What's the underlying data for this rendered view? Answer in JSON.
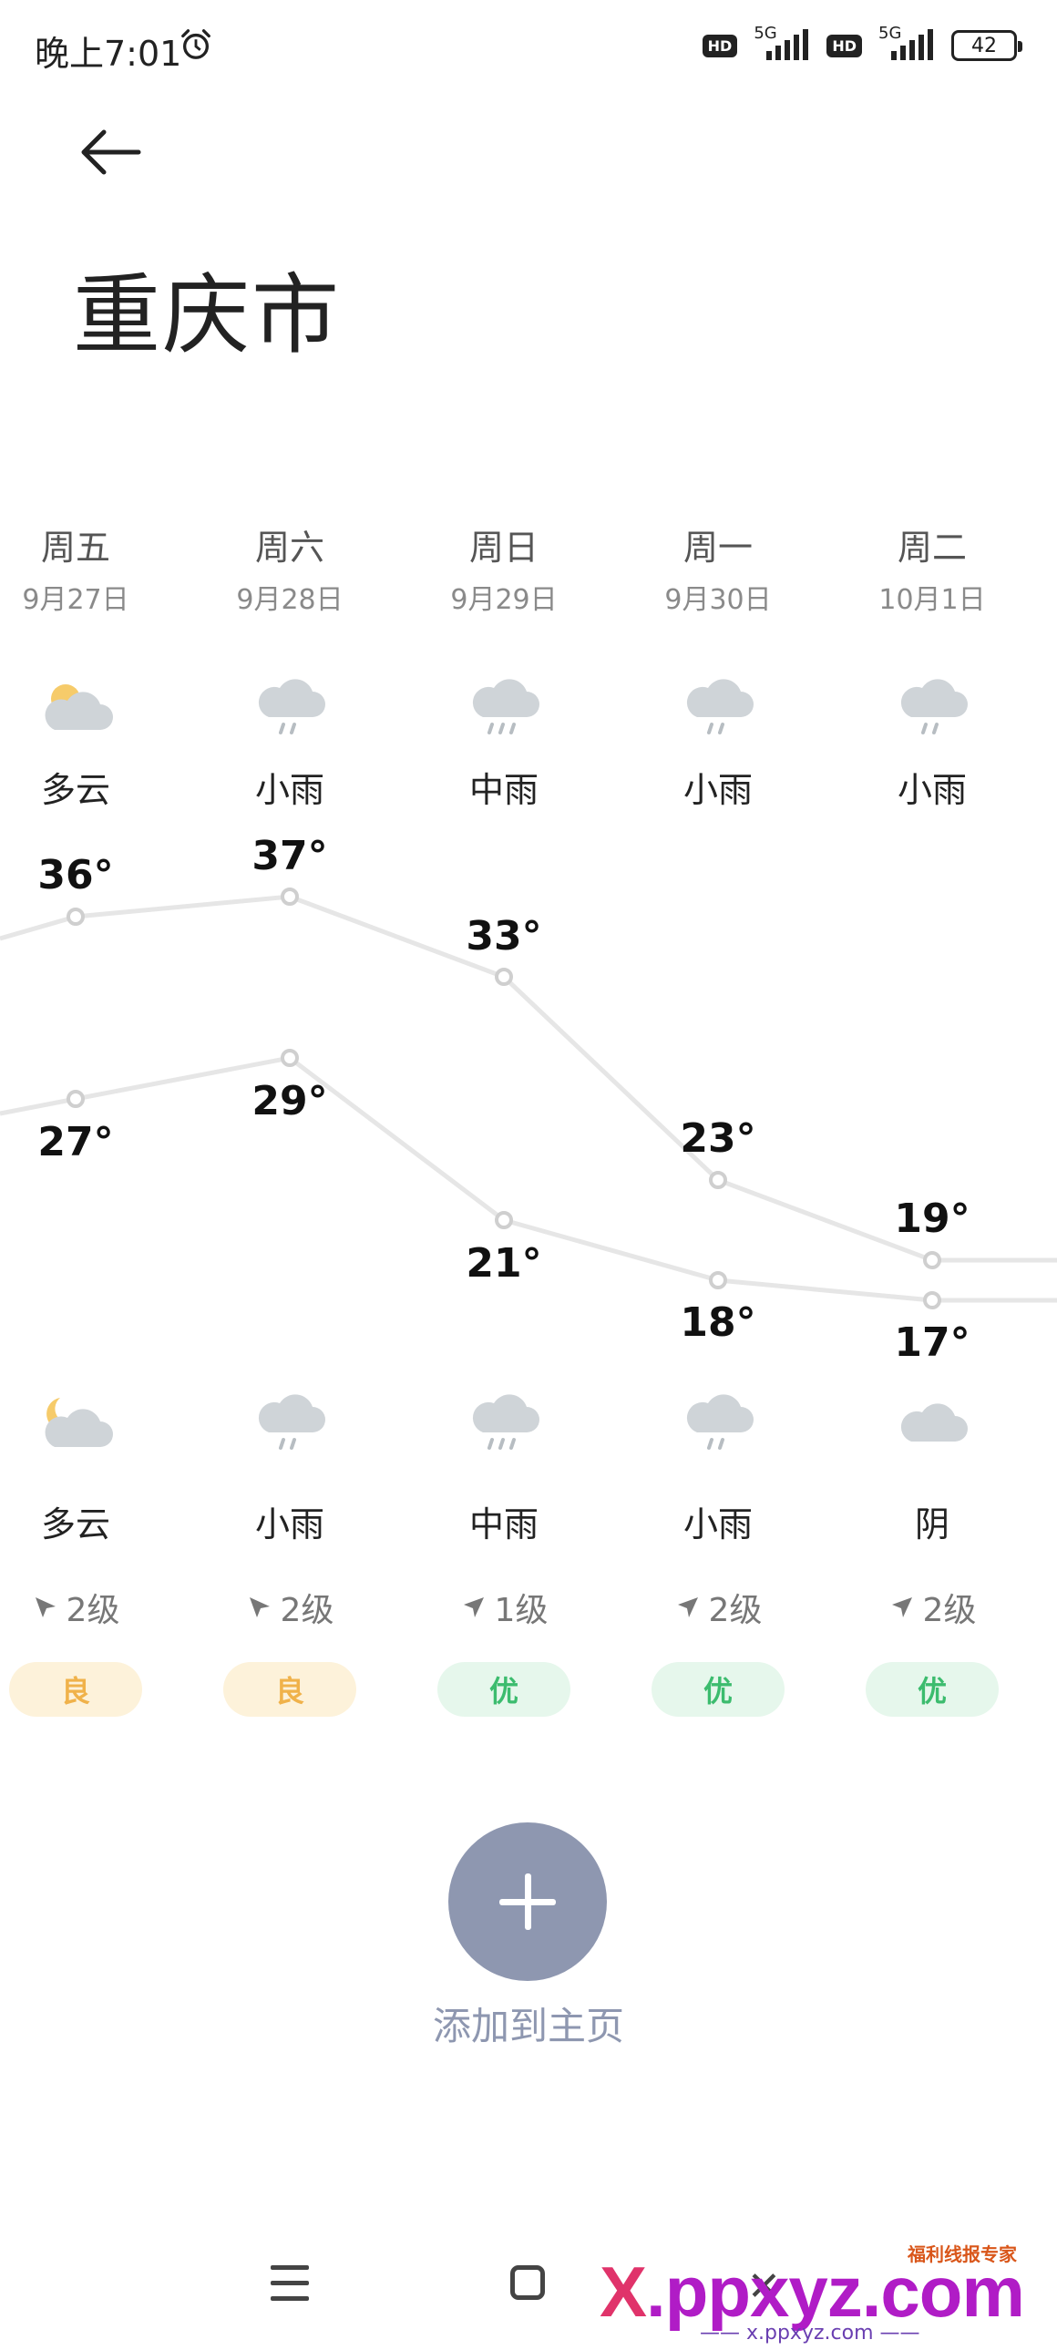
{
  "status_bar": {
    "time": "晚上7:01",
    "hd1": "HD",
    "net1": "5G",
    "hd2": "HD",
    "net2": "5G",
    "battery": "42"
  },
  "header": {
    "city": "重庆市"
  },
  "forecast": [
    {
      "day": "周五",
      "date": "9月27日",
      "day_cond": "多云",
      "day_icon": "partly-cloudy-sun-icon",
      "high": "36°",
      "low": "27°",
      "night_cond": "多云",
      "night_icon": "partly-cloudy-moon-icon",
      "wind": "2级",
      "aqi": "良"
    },
    {
      "day": "周六",
      "date": "9月28日",
      "day_cond": "小雨",
      "day_icon": "light-rain-icon",
      "high": "37°",
      "low": "29°",
      "night_cond": "小雨",
      "night_icon": "light-rain-icon",
      "wind": "2级",
      "aqi": "良"
    },
    {
      "day": "周日",
      "date": "9月29日",
      "day_cond": "中雨",
      "day_icon": "moderate-rain-icon",
      "high": "33°",
      "low": "21°",
      "night_cond": "中雨",
      "night_icon": "moderate-rain-icon",
      "wind": "1级",
      "aqi": "优"
    },
    {
      "day": "周一",
      "date": "9月30日",
      "day_cond": "小雨",
      "day_icon": "light-rain-icon",
      "high": "23°",
      "low": "18°",
      "night_cond": "小雨",
      "night_icon": "light-rain-icon",
      "wind": "2级",
      "aqi": "优"
    },
    {
      "day": "周二",
      "date": "10月1日",
      "day_cond": "小雨",
      "day_icon": "light-rain-icon",
      "high": "19°",
      "low": "17°",
      "night_cond": "阴",
      "night_icon": "overcast-cloud-icon",
      "wind": "2级",
      "aqi": "优"
    }
  ],
  "add_button": {
    "label": "添加到主页"
  },
  "watermark": {
    "main_x": "X",
    "main_rest": ".ppxyz.com",
    "tag": "福利线报专家",
    "sub": "—— x.ppxyz.com ——"
  },
  "colors": {
    "aqi_good_bg": "#fdf2da",
    "aqi_good_text": "#f0b24a",
    "aqi_excellent_bg": "#e6f7ec",
    "aqi_excellent_text": "#3cbc6e",
    "add_button": "#8e97b0"
  }
}
